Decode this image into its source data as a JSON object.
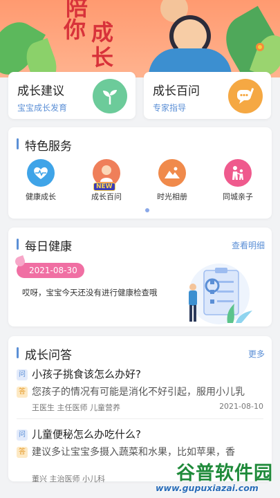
{
  "banner": {
    "title_chars": [
      "陪",
      "你",
      "成",
      "长"
    ]
  },
  "quick_cards": [
    {
      "title": "成长建议",
      "subtitle": "宝宝成长发育",
      "icon": "sprout-icon"
    },
    {
      "title": "成长百问",
      "subtitle": "专家指导",
      "icon": "chat-bubble-icon"
    }
  ],
  "services": {
    "title": "特色服务",
    "items": [
      {
        "label": "健康成长",
        "icon": "heartbeat-icon",
        "color": "#3fa4e8"
      },
      {
        "label": "成长百问",
        "icon": "child-avatar-icon",
        "color": "#ef7f5a",
        "badge": "NEW"
      },
      {
        "label": "时光相册",
        "icon": "mountain-photo-icon",
        "color": "#f08a4b"
      },
      {
        "label": "同城亲子",
        "icon": "parent-child-icon",
        "color": "#ef5a8d"
      }
    ]
  },
  "daily_health": {
    "title": "每日健康",
    "link": "查看明细",
    "date": "2021-08-30",
    "message": "哎呀，宝宝今天还没有进行健康检查哦"
  },
  "qa": {
    "title": "成长问答",
    "more": "更多",
    "q_tag": "问",
    "a_tag": "答",
    "items": [
      {
        "question": "小孩子挑食该怎么办好?",
        "answer": "您孩子的情况有可能是消化不好引起，服用小儿乳",
        "meta": "王医生 主任医师 儿童营养",
        "date": "2021-08-10"
      },
      {
        "question": "儿童便秘怎么办吃什么?",
        "answer": "建议多让宝宝多摄入蔬菜和水果，比如苹果，香",
        "meta": "董兴 主治医师 小儿科",
        "date": ""
      }
    ]
  },
  "watermark": {
    "text": "谷普软件园",
    "url": "www.gupuxiazai.com"
  }
}
